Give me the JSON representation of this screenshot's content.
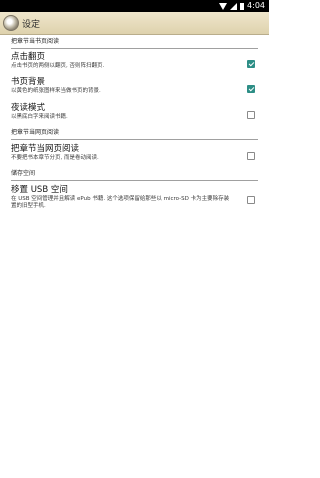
{
  "status_bar": {
    "time": "4:04"
  },
  "app_bar": {
    "title": "设定"
  },
  "categories": [
    {
      "title": "把章节当书页阅读",
      "items": [
        {
          "title": "点击翻页",
          "summary": "点击书页的两侧以翻页, 否则阵扫翻页.",
          "checked": true
        },
        {
          "title": "书页背景",
          "summary": "以黄色的纸张图样来当做书页的背景.",
          "checked": true
        },
        {
          "title": "夜读模式",
          "summary": "以黑底白字来阅读书籍.",
          "checked": false
        }
      ]
    },
    {
      "title": "把章节当网页阅读",
      "items": [
        {
          "title": "把章节当网页阅读",
          "summary": "不要把书本章节分页, 而是卷动阅读.",
          "checked": false
        }
      ]
    },
    {
      "title": "储存空间",
      "items": [
        {
          "title": "移置 USB 空间",
          "summary": "在 USB 空间管理并且解读 ePub 书籍. 这个选项保留给那些以 micro-SD 卡为主要除存装置的旧型手机.",
          "checked": false
        }
      ]
    }
  ]
}
